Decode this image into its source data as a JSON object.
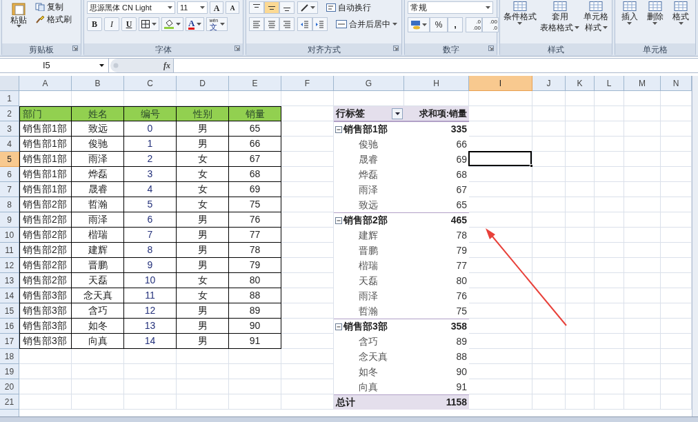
{
  "ribbon": {
    "groups": [
      {
        "kind": "clipboard",
        "label": "剪贴板",
        "paste": "粘贴",
        "copy": "复制",
        "format_painter": "格式刷"
      },
      {
        "kind": "font",
        "label": "字体",
        "font_name": "思源黑体 CN Light",
        "font_size": "11",
        "grow": "A",
        "shrink": "A",
        "bold": "B",
        "italic": "I",
        "underline": "U",
        "font_color": "A",
        "phonetic_top": "wén",
        "phonetic": "文"
      },
      {
        "kind": "alignment",
        "label": "对齐方式",
        "vertical_align": [
          {
            "selected": false
          },
          {
            "selected": true
          },
          {
            "selected": false
          }
        ],
        "wrap": "自动换行",
        "merge": "合并后居中"
      },
      {
        "kind": "number",
        "label": "数字",
        "format": "常规",
        "percent": "%",
        "comma": ",",
        "increase_decimal": [
          ".0",
          ".00"
        ],
        "decrease_decimal": [
          ".00",
          ".0"
        ]
      },
      {
        "kind": "styles",
        "label": "样式",
        "buttons": [
          [
            "条件格式"
          ],
          [
            "套用",
            "表格格式"
          ],
          [
            "单元格",
            "样式"
          ]
        ]
      },
      {
        "kind": "cells",
        "label": "单元格",
        "buttons": [
          "插入",
          "删除",
          "格式"
        ]
      }
    ]
  },
  "formula_bar": {
    "name_box": "I5",
    "fx": "fx"
  },
  "columns": [
    {
      "label": "A",
      "selected": false
    },
    {
      "label": "B",
      "selected": false
    },
    {
      "label": "C",
      "selected": false
    },
    {
      "label": "D",
      "selected": false
    },
    {
      "label": "E",
      "selected": false
    },
    {
      "label": "F",
      "selected": false
    },
    {
      "label": "G",
      "selected": false
    },
    {
      "label": "H",
      "selected": false
    },
    {
      "label": "I",
      "selected": true
    },
    {
      "label": "J",
      "selected": false
    },
    {
      "label": "K",
      "selected": false
    },
    {
      "label": "L",
      "selected": false
    },
    {
      "label": "M",
      "selected": false
    },
    {
      "label": "N",
      "selected": false
    }
  ],
  "rows": [
    {
      "label": "1",
      "selected": false
    },
    {
      "label": "2",
      "selected": false
    },
    {
      "label": "3",
      "selected": false
    },
    {
      "label": "4",
      "selected": false
    },
    {
      "label": "5",
      "selected": true
    },
    {
      "label": "6",
      "selected": false
    },
    {
      "label": "7",
      "selected": false
    },
    {
      "label": "8",
      "selected": false
    },
    {
      "label": "9",
      "selected": false
    },
    {
      "label": "10",
      "selected": false
    },
    {
      "label": "11",
      "selected": false
    },
    {
      "label": "12",
      "selected": false
    },
    {
      "label": "13",
      "selected": false
    },
    {
      "label": "14",
      "selected": false
    },
    {
      "label": "15",
      "selected": false
    },
    {
      "label": "16",
      "selected": false
    },
    {
      "label": "17",
      "selected": false
    },
    {
      "label": "18",
      "selected": false
    },
    {
      "label": "19",
      "selected": false
    },
    {
      "label": "20",
      "selected": false
    },
    {
      "label": "21",
      "selected": false
    }
  ],
  "data_table": {
    "header": [
      "部门",
      "姓名",
      "编号",
      "性别",
      "销量"
    ],
    "rows": [
      [
        "销售部1部",
        "致远",
        "0",
        "男",
        "65"
      ],
      [
        "销售部1部",
        "俊驰",
        "1",
        "男",
        "66"
      ],
      [
        "销售部1部",
        "雨泽",
        "2",
        "女",
        "67"
      ],
      [
        "销售部1部",
        "烨磊",
        "3",
        "女",
        "68"
      ],
      [
        "销售部1部",
        "晟睿",
        "4",
        "女",
        "69"
      ],
      [
        "销售部2部",
        "哲瀚",
        "5",
        "女",
        "75"
      ],
      [
        "销售部2部",
        "雨泽",
        "6",
        "男",
        "76"
      ],
      [
        "销售部2部",
        "楷瑞",
        "7",
        "男",
        "77"
      ],
      [
        "销售部2部",
        "建辉",
        "8",
        "男",
        "78"
      ],
      [
        "销售部2部",
        "晋鹏",
        "9",
        "男",
        "79"
      ],
      [
        "销售部2部",
        "天磊",
        "10",
        "女",
        "80"
      ],
      [
        "销售部3部",
        "念天真",
        "11",
        "女",
        "88"
      ],
      [
        "销售部3部",
        "含巧",
        "12",
        "男",
        "89"
      ],
      [
        "销售部3部",
        "如冬",
        "13",
        "男",
        "90"
      ],
      [
        "销售部3部",
        "向真",
        "14",
        "男",
        "91"
      ]
    ]
  },
  "pivot": {
    "header": [
      "行标签",
      "求和项:销量"
    ],
    "rows": [
      {
        "kind": "group",
        "label": "销售部1部",
        "value": "335",
        "expanded": true
      },
      {
        "kind": "item",
        "label": "俊驰",
        "value": "66"
      },
      {
        "kind": "item",
        "label": "晟睿",
        "value": "69"
      },
      {
        "kind": "item",
        "label": "烨磊",
        "value": "68"
      },
      {
        "kind": "item",
        "label": "雨泽",
        "value": "67"
      },
      {
        "kind": "item",
        "label": "致远",
        "value": "65"
      },
      {
        "kind": "group",
        "label": "销售部2部",
        "value": "465",
        "expanded": true
      },
      {
        "kind": "item",
        "label": "建辉",
        "value": "78"
      },
      {
        "kind": "item",
        "label": "晋鹏",
        "value": "79"
      },
      {
        "kind": "item",
        "label": "楷瑞",
        "value": "77"
      },
      {
        "kind": "item",
        "label": "天磊",
        "value": "80"
      },
      {
        "kind": "item",
        "label": "雨泽",
        "value": "76"
      },
      {
        "kind": "item",
        "label": "哲瀚",
        "value": "75"
      },
      {
        "kind": "group",
        "label": "销售部3部",
        "value": "358",
        "expanded": true
      },
      {
        "kind": "item",
        "label": "含巧",
        "value": "89"
      },
      {
        "kind": "item",
        "label": "念天真",
        "value": "88"
      },
      {
        "kind": "item",
        "label": "如冬",
        "value": "90"
      },
      {
        "kind": "item",
        "label": "向真",
        "value": "91"
      },
      {
        "kind": "total",
        "label": "总计",
        "value": "1158"
      }
    ]
  }
}
